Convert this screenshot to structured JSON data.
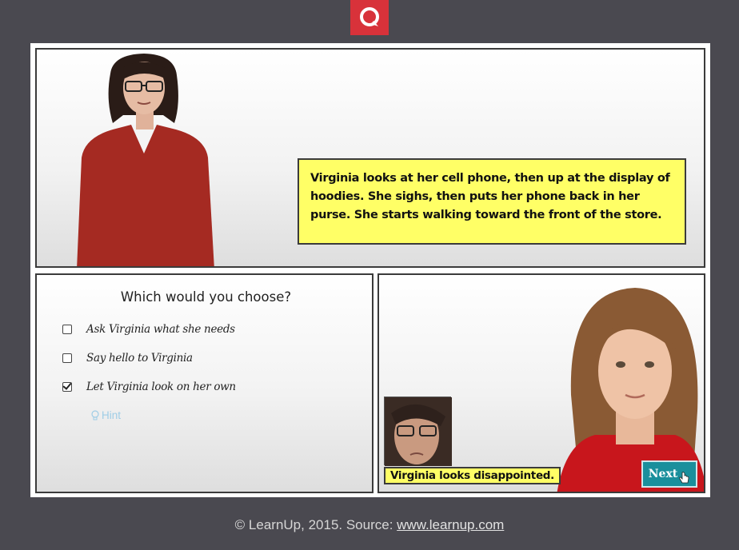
{
  "narration": "Virginia looks at her cell phone, then up at the display of hoodies. She sighs, then puts her phone back in her purse. She starts walking toward the front of the store.",
  "question": "Which would you choose?",
  "options": [
    {
      "label": "Ask Virginia what she needs",
      "checked": false
    },
    {
      "label": "Say hello to Virginia",
      "checked": false
    },
    {
      "label": "Let Virginia look on her own",
      "checked": true
    }
  ],
  "hint_label": "Hint",
  "reaction_caption": "Virginia looks disappointed.",
  "next_label": "Next",
  "footer": {
    "copyright": "© LearnUp, 2015. Source: ",
    "link": "www.learnup.com"
  },
  "colors": {
    "brand_red": "#d8323a",
    "callout_yellow": "#ffff66",
    "next_teal": "#1a8f9c",
    "background": "#4a4950"
  }
}
